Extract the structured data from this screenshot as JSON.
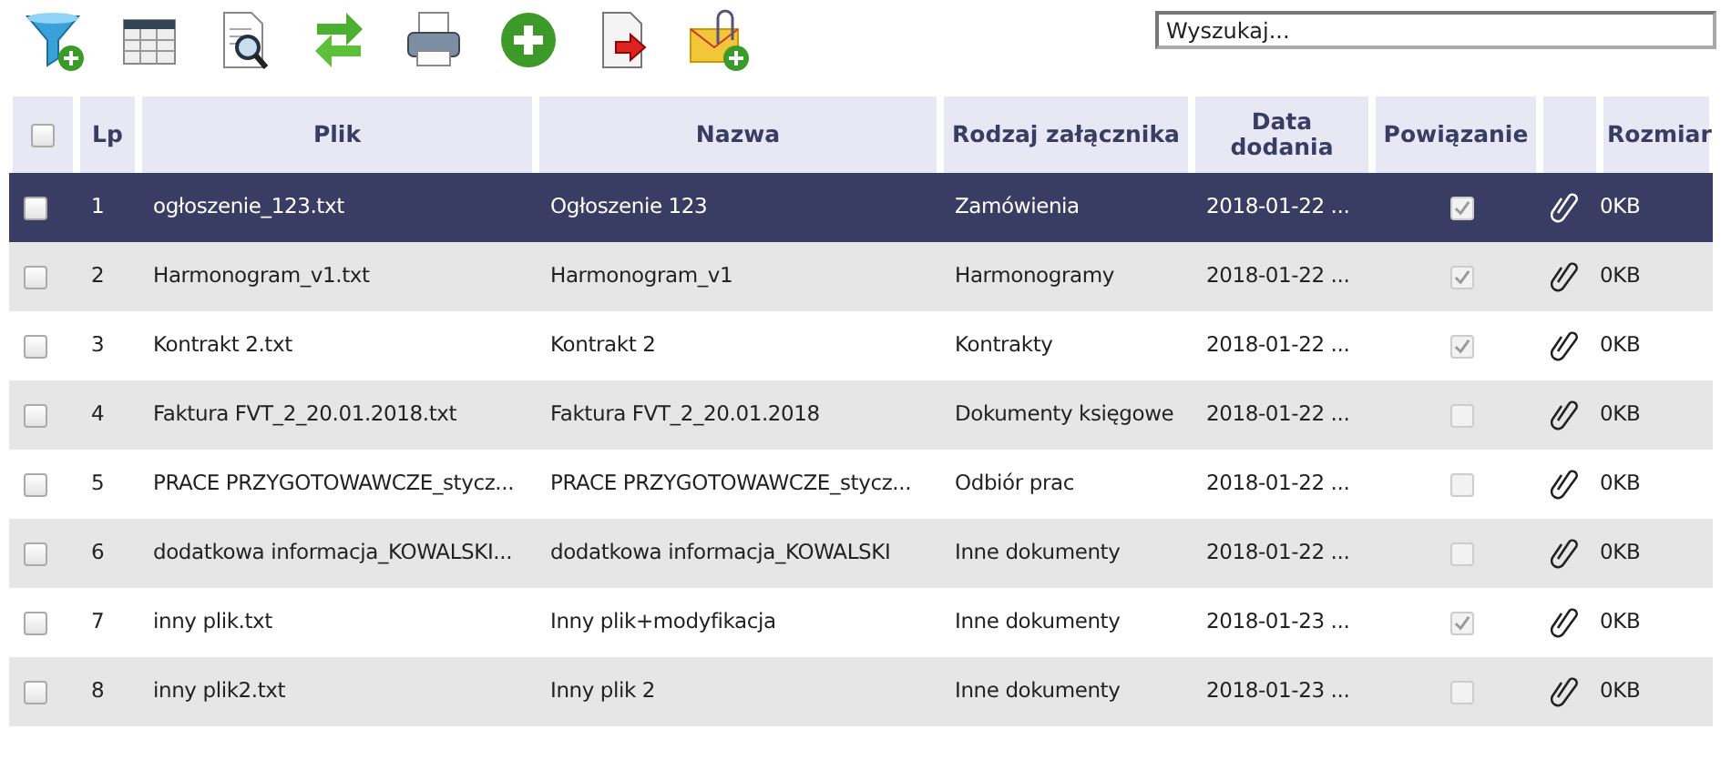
{
  "search": {
    "placeholder": "Wyszukaj..."
  },
  "table": {
    "select_all": {
      "checked": false
    },
    "columns": [
      "Lp",
      "Plik",
      "Nazwa",
      "Rodzaj załącznika",
      "Data dodania",
      "Powiązanie",
      "Rozmiar"
    ],
    "rows": [
      {
        "checked": false,
        "lp": "1",
        "file": "ogłoszenie_123.txt",
        "name": "Ogłoszenie 123",
        "type": "Zamówienia",
        "date": "2018-01-22 ...",
        "linked": true,
        "size": "0KB",
        "selected": true
      },
      {
        "checked": false,
        "lp": "2",
        "file": "Harmonogram_v1.txt",
        "name": "Harmonogram_v1",
        "type": "Harmonogramy",
        "date": "2018-01-22 ...",
        "linked": true,
        "size": "0KB",
        "selected": false
      },
      {
        "checked": false,
        "lp": "3",
        "file": "Kontrakt 2.txt",
        "name": "Kontrakt 2",
        "type": "Kontrakty",
        "date": "2018-01-22 ...",
        "linked": true,
        "size": "0KB",
        "selected": false
      },
      {
        "checked": false,
        "lp": "4",
        "file": "Faktura FVT_2_20.01.2018.txt",
        "name": "Faktura FVT_2_20.01.2018",
        "type": "Dokumenty księgowe",
        "date": "2018-01-22 ...",
        "linked": false,
        "size": "0KB",
        "selected": false
      },
      {
        "checked": false,
        "lp": "5",
        "file": "PRACE PRZYGOTOWAWCZE_stycz...",
        "name": "PRACE PRZYGOTOWAWCZE_stycz...",
        "type": "Odbiór prac",
        "date": "2018-01-22 ...",
        "linked": false,
        "size": "0KB",
        "selected": false
      },
      {
        "checked": false,
        "lp": "6",
        "file": "dodatkowa informacja_KOWALSKI...",
        "name": "dodatkowa informacja_KOWALSKI",
        "type": "Inne dokumenty",
        "date": "2018-01-22 ...",
        "linked": false,
        "size": "0KB",
        "selected": false
      },
      {
        "checked": false,
        "lp": "7",
        "file": "inny plik.txt",
        "name": "Inny plik+modyfikacja",
        "type": "Inne dokumenty",
        "date": "2018-01-23 ...",
        "linked": true,
        "size": "0KB",
        "selected": false
      },
      {
        "checked": false,
        "lp": "8",
        "file": "inny plik2.txt",
        "name": "Inny plik 2",
        "type": "Inne dokumenty",
        "date": "2018-01-23 ...",
        "linked": false,
        "size": "0KB",
        "selected": false
      }
    ]
  }
}
